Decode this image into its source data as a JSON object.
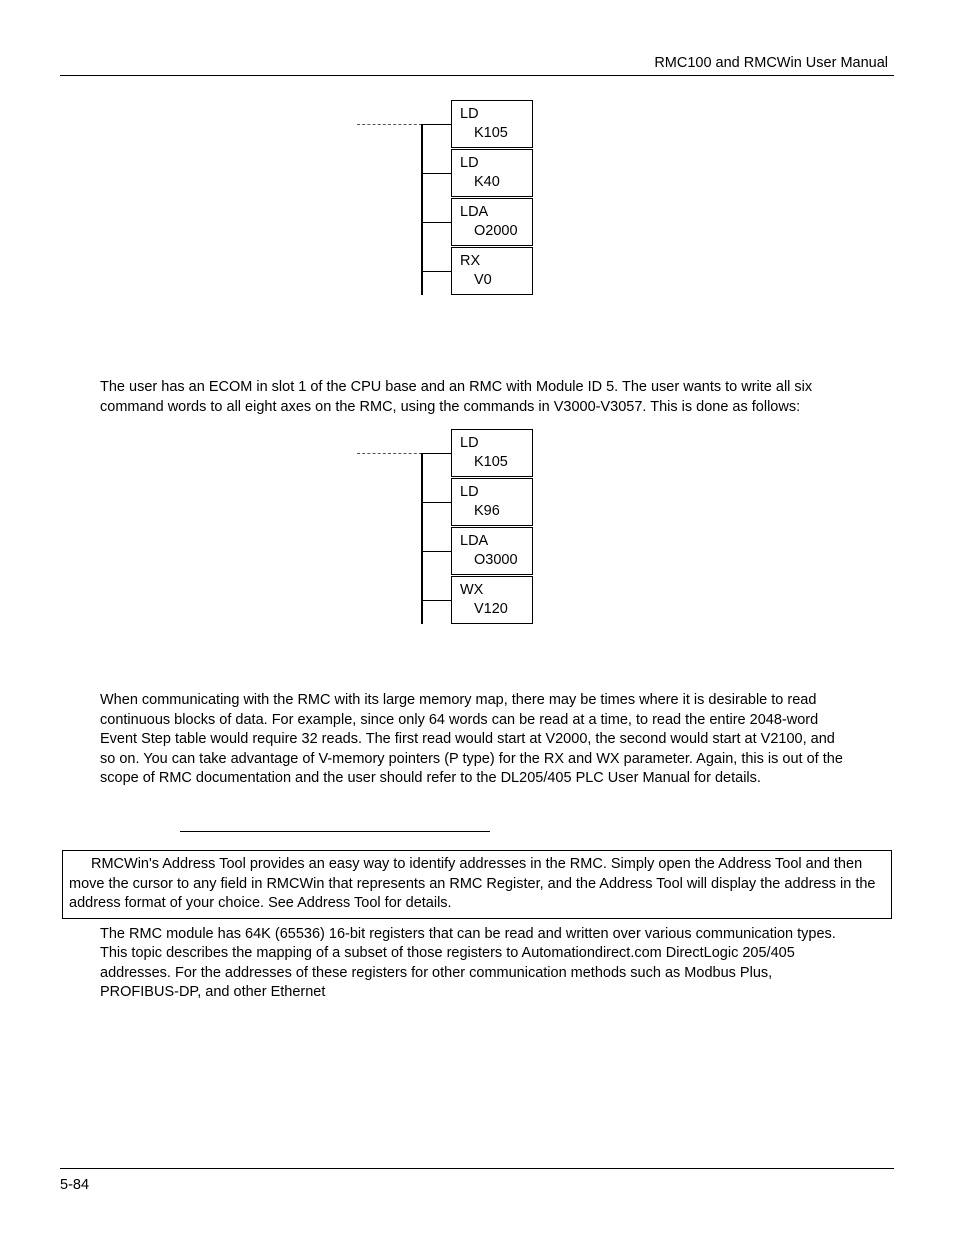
{
  "header": {
    "title": "RMC100 and RMCWin User Manual"
  },
  "ladder1": {
    "boxes": [
      {
        "l1": "LD",
        "l2": "K105"
      },
      {
        "l1": "LD",
        "l2": "K40"
      },
      {
        "l1": "LDA",
        "l2": "O2000"
      },
      {
        "l1": "RX",
        "l2": "V0"
      }
    ]
  },
  "para1": "The user has an ECOM in slot 1 of the CPU base and an RMC with Module ID 5. The user wants to write all six command words to all eight axes on the RMC, using the commands in V3000-V3057. This is done as follows:",
  "ladder2": {
    "boxes": [
      {
        "l1": "LD",
        "l2": "K105"
      },
      {
        "l1": "LD",
        "l2": "K96"
      },
      {
        "l1": "LDA",
        "l2": "O3000"
      },
      {
        "l1": "WX",
        "l2": "V120"
      }
    ]
  },
  "para2": "When communicating with the RMC with its large memory map, there may be times where it is desirable to read continuous blocks of data. For example, since only 64 words can be read at a time, to read the entire 2048-word Event Step table would require 32 reads. The first read would start at V2000, the second would start at V2100, and so on. You can take advantage of V-memory pointers (P type) for the RX and WX parameter. Again, this is out of the scope of RMC documentation and the user should refer to the DL205/405 PLC User Manual for details.",
  "note": "RMCWin's Address Tool provides an easy way to identify addresses in the RMC. Simply open the Address Tool and then move the cursor to any field in RMCWin that represents an RMC Register, and the Address Tool will display the address in the address format of your choice. See Address Tool for details.",
  "para3": "The RMC module has 64K (65536) 16-bit registers that can be read and written over various communication types. This topic describes the mapping of a subset of those registers to Automationdirect.com DirectLogic 205/405 addresses. For the addresses of these registers for other communication methods such as Modbus Plus, PROFIBUS-DP, and other Ethernet",
  "footer": {
    "page": "5-84"
  }
}
